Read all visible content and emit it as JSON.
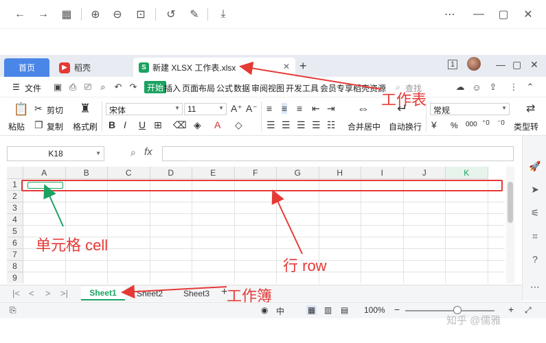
{
  "tabs": {
    "home": "首页",
    "daoke": "稻壳",
    "active_file": "新建 XLSX 工作表.xlsx",
    "window_badge": "1"
  },
  "menu": {
    "file": "文件",
    "items": [
      "开始",
      "插入",
      "页面布局",
      "公式",
      "数据",
      "审阅",
      "视图",
      "开发工具",
      "会员专享",
      "稻壳资源"
    ],
    "search": "查找"
  },
  "ribbon": {
    "paste": "粘贴",
    "cut": "剪切",
    "copy": "复制",
    "format_painter": "格式刷",
    "font_name": "宋体",
    "font_size": "11",
    "merge": "合并居中",
    "wrap": "自动换行",
    "number_format": "常规",
    "type_convert": "类型转",
    "percent": "%",
    "thousands": "000"
  },
  "formula_bar": {
    "name_box": "K18",
    "fx_label": "fx"
  },
  "grid": {
    "columns": [
      "A",
      "B",
      "C",
      "D",
      "E",
      "F",
      "G",
      "H",
      "I",
      "J",
      "K"
    ],
    "selected_column": "K",
    "rows": [
      "1",
      "2",
      "3",
      "4",
      "5",
      "6",
      "7",
      "8",
      "9"
    ]
  },
  "sheets": {
    "tabs": [
      "Sheet1",
      "Sheet2",
      "Sheet3"
    ],
    "active": "Sheet1",
    "add": "+"
  },
  "status": {
    "zoom": "100%"
  },
  "annotations": {
    "worksheet": "工作表",
    "cell": "单元格 cell",
    "row": "行 row",
    "workbook": "工作簿",
    "colors": {
      "annotation_red": "#e53935",
      "arrow_green": "#1aa260"
    }
  },
  "watermark": "知乎 @儒雅",
  "colors": {
    "tab_blue": "#4a86e8",
    "wps_green": "#1aa260"
  }
}
